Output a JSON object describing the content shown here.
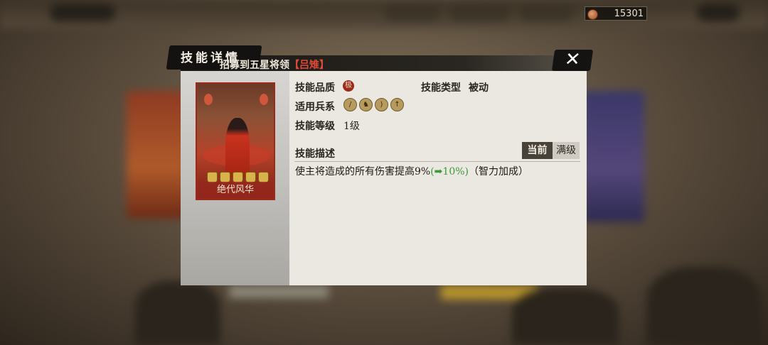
{
  "currency": {
    "value": "15301",
    "icon": "copper-coin-icon"
  },
  "dialog": {
    "title": "技能详情",
    "subtitle_prefix": "招募到五星将领",
    "subtitle_hero": "【吕雉】",
    "close_symbol": "✕"
  },
  "card": {
    "name": "绝代风华",
    "stars": 5
  },
  "info": {
    "quality_label": "技能品质",
    "quality_badge": "极",
    "type_label": "技能类型",
    "type_value": "被动",
    "troops_label": "适用兵系",
    "troop_icons": [
      "spear-icon",
      "cavalry-icon",
      "bow-icon",
      "halberd-icon"
    ],
    "level_label": "技能等级",
    "level_value": "1级",
    "desc_label": "技能描述"
  },
  "tabs": {
    "current": "当前",
    "max": "满级"
  },
  "description": {
    "main": "使主将造成的所有伤害提高9%",
    "bonus": "(➡10%)",
    "note": "（智力加成）"
  },
  "colors": {
    "highlight_red": "#e04a3a",
    "bonus_green": "#3c9a3c",
    "panel": "#ebe7e1"
  }
}
